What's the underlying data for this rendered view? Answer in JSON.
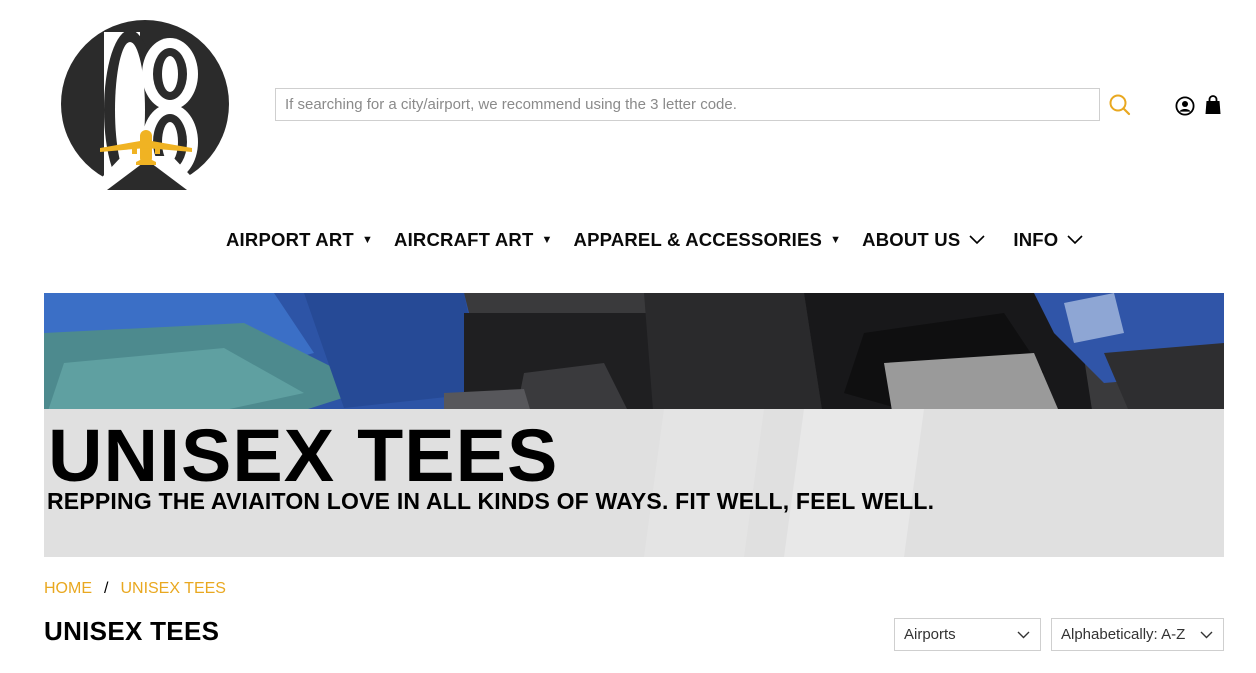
{
  "search": {
    "placeholder": "If searching for a city/airport, we recommend using the 3 letter code.",
    "value": ""
  },
  "icons": {
    "logo": "logo-mark",
    "search": "search-icon",
    "account": "account-icon",
    "cart": "cart-icon"
  },
  "nav": {
    "items": [
      {
        "label": "AIRPORT ART",
        "indicator": "dropdown-arrow"
      },
      {
        "label": "AIRCRAFT ART",
        "indicator": "dropdown-arrow"
      },
      {
        "label": "APPAREL & ACCESSORIES",
        "indicator": "dropdown-arrow"
      },
      {
        "label": "ABOUT US",
        "indicator": "chevron-down"
      },
      {
        "label": "INFO",
        "indicator": "chevron-down"
      }
    ]
  },
  "banner": {
    "title": "UNISEX TEES",
    "subtitle": "REPPING THE AVIAITON LOVE IN ALL KINDS OF WAYS. FIT WELL, FEEL WELL."
  },
  "breadcrumb": {
    "home": "HOME",
    "separator": "/",
    "current": "UNISEX TEES"
  },
  "page": {
    "title": "UNISEX TEES"
  },
  "filters": {
    "category": "Airports",
    "sort": "Alphabetically: A-Z"
  },
  "colors": {
    "accent": "#e9a820",
    "text": "#0a0a0a",
    "logo_dark": "#2b2b2b"
  }
}
